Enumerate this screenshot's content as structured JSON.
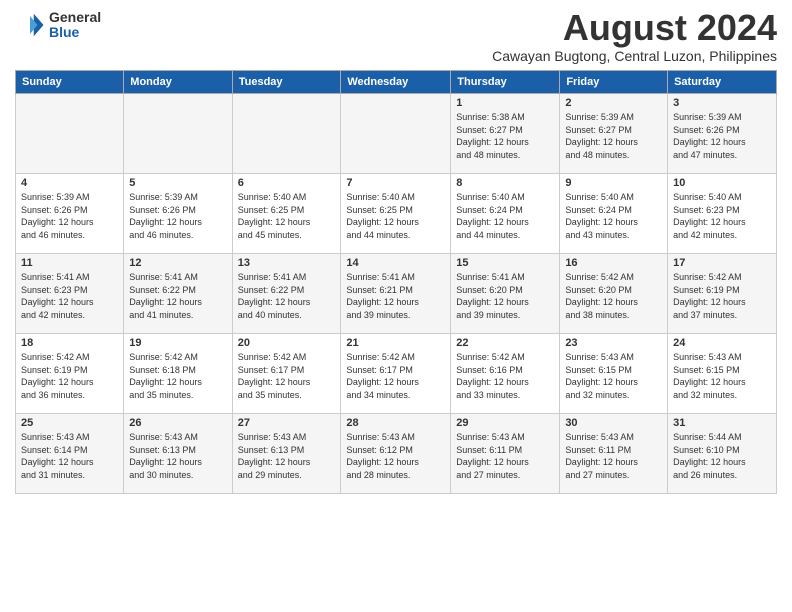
{
  "logo": {
    "general": "General",
    "blue": "Blue"
  },
  "title": {
    "month_year": "August 2024",
    "location": "Cawayan Bugtong, Central Luzon, Philippines"
  },
  "days_of_week": [
    "Sunday",
    "Monday",
    "Tuesday",
    "Wednesday",
    "Thursday",
    "Friday",
    "Saturday"
  ],
  "weeks": [
    [
      {
        "day": "",
        "info": ""
      },
      {
        "day": "",
        "info": ""
      },
      {
        "day": "",
        "info": ""
      },
      {
        "day": "",
        "info": ""
      },
      {
        "day": "1",
        "info": "Sunrise: 5:38 AM\nSunset: 6:27 PM\nDaylight: 12 hours\nand 48 minutes."
      },
      {
        "day": "2",
        "info": "Sunrise: 5:39 AM\nSunset: 6:27 PM\nDaylight: 12 hours\nand 48 minutes."
      },
      {
        "day": "3",
        "info": "Sunrise: 5:39 AM\nSunset: 6:26 PM\nDaylight: 12 hours\nand 47 minutes."
      }
    ],
    [
      {
        "day": "4",
        "info": "Sunrise: 5:39 AM\nSunset: 6:26 PM\nDaylight: 12 hours\nand 46 minutes."
      },
      {
        "day": "5",
        "info": "Sunrise: 5:39 AM\nSunset: 6:26 PM\nDaylight: 12 hours\nand 46 minutes."
      },
      {
        "day": "6",
        "info": "Sunrise: 5:40 AM\nSunset: 6:25 PM\nDaylight: 12 hours\nand 45 minutes."
      },
      {
        "day": "7",
        "info": "Sunrise: 5:40 AM\nSunset: 6:25 PM\nDaylight: 12 hours\nand 44 minutes."
      },
      {
        "day": "8",
        "info": "Sunrise: 5:40 AM\nSunset: 6:24 PM\nDaylight: 12 hours\nand 44 minutes."
      },
      {
        "day": "9",
        "info": "Sunrise: 5:40 AM\nSunset: 6:24 PM\nDaylight: 12 hours\nand 43 minutes."
      },
      {
        "day": "10",
        "info": "Sunrise: 5:40 AM\nSunset: 6:23 PM\nDaylight: 12 hours\nand 42 minutes."
      }
    ],
    [
      {
        "day": "11",
        "info": "Sunrise: 5:41 AM\nSunset: 6:23 PM\nDaylight: 12 hours\nand 42 minutes."
      },
      {
        "day": "12",
        "info": "Sunrise: 5:41 AM\nSunset: 6:22 PM\nDaylight: 12 hours\nand 41 minutes."
      },
      {
        "day": "13",
        "info": "Sunrise: 5:41 AM\nSunset: 6:22 PM\nDaylight: 12 hours\nand 40 minutes."
      },
      {
        "day": "14",
        "info": "Sunrise: 5:41 AM\nSunset: 6:21 PM\nDaylight: 12 hours\nand 39 minutes."
      },
      {
        "day": "15",
        "info": "Sunrise: 5:41 AM\nSunset: 6:20 PM\nDaylight: 12 hours\nand 39 minutes."
      },
      {
        "day": "16",
        "info": "Sunrise: 5:42 AM\nSunset: 6:20 PM\nDaylight: 12 hours\nand 38 minutes."
      },
      {
        "day": "17",
        "info": "Sunrise: 5:42 AM\nSunset: 6:19 PM\nDaylight: 12 hours\nand 37 minutes."
      }
    ],
    [
      {
        "day": "18",
        "info": "Sunrise: 5:42 AM\nSunset: 6:19 PM\nDaylight: 12 hours\nand 36 minutes."
      },
      {
        "day": "19",
        "info": "Sunrise: 5:42 AM\nSunset: 6:18 PM\nDaylight: 12 hours\nand 35 minutes."
      },
      {
        "day": "20",
        "info": "Sunrise: 5:42 AM\nSunset: 6:17 PM\nDaylight: 12 hours\nand 35 minutes."
      },
      {
        "day": "21",
        "info": "Sunrise: 5:42 AM\nSunset: 6:17 PM\nDaylight: 12 hours\nand 34 minutes."
      },
      {
        "day": "22",
        "info": "Sunrise: 5:42 AM\nSunset: 6:16 PM\nDaylight: 12 hours\nand 33 minutes."
      },
      {
        "day": "23",
        "info": "Sunrise: 5:43 AM\nSunset: 6:15 PM\nDaylight: 12 hours\nand 32 minutes."
      },
      {
        "day": "24",
        "info": "Sunrise: 5:43 AM\nSunset: 6:15 PM\nDaylight: 12 hours\nand 32 minutes."
      }
    ],
    [
      {
        "day": "25",
        "info": "Sunrise: 5:43 AM\nSunset: 6:14 PM\nDaylight: 12 hours\nand 31 minutes."
      },
      {
        "day": "26",
        "info": "Sunrise: 5:43 AM\nSunset: 6:13 PM\nDaylight: 12 hours\nand 30 minutes."
      },
      {
        "day": "27",
        "info": "Sunrise: 5:43 AM\nSunset: 6:13 PM\nDaylight: 12 hours\nand 29 minutes."
      },
      {
        "day": "28",
        "info": "Sunrise: 5:43 AM\nSunset: 6:12 PM\nDaylight: 12 hours\nand 28 minutes."
      },
      {
        "day": "29",
        "info": "Sunrise: 5:43 AM\nSunset: 6:11 PM\nDaylight: 12 hours\nand 27 minutes."
      },
      {
        "day": "30",
        "info": "Sunrise: 5:43 AM\nSunset: 6:11 PM\nDaylight: 12 hours\nand 27 minutes."
      },
      {
        "day": "31",
        "info": "Sunrise: 5:44 AM\nSunset: 6:10 PM\nDaylight: 12 hours\nand 26 minutes."
      }
    ]
  ]
}
